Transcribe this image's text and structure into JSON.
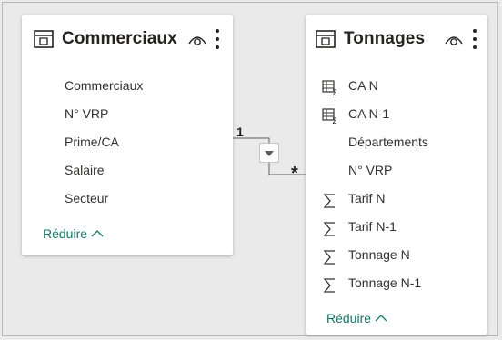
{
  "left_table": {
    "title": "Commerciaux",
    "fields": [
      "Commerciaux",
      "N° VRP",
      "Prime/CA",
      "Salaire",
      "Secteur"
    ],
    "collapse_label": "Réduire"
  },
  "right_table": {
    "title": "Tonnages",
    "fields": [
      {
        "label": "CA N",
        "icon": "measure-table-icon"
      },
      {
        "label": "CA N-1",
        "icon": "measure-table-icon"
      },
      {
        "label": "Départements",
        "icon": "none"
      },
      {
        "label": "N° VRP",
        "icon": "none"
      },
      {
        "label": "Tarif N",
        "icon": "sigma-icon"
      },
      {
        "label": "Tarif N-1",
        "icon": "sigma-icon"
      },
      {
        "label": "Tonnage N",
        "icon": "sigma-icon"
      },
      {
        "label": "Tonnage N-1",
        "icon": "sigma-icon"
      }
    ],
    "collapse_label": "Réduire"
  },
  "relationship": {
    "from_cardinality": "1",
    "to_cardinality": "*",
    "filter_direction": "single"
  },
  "colors": {
    "accent_link": "#117865",
    "line": "#605e5c",
    "background": "#eaeaea"
  }
}
